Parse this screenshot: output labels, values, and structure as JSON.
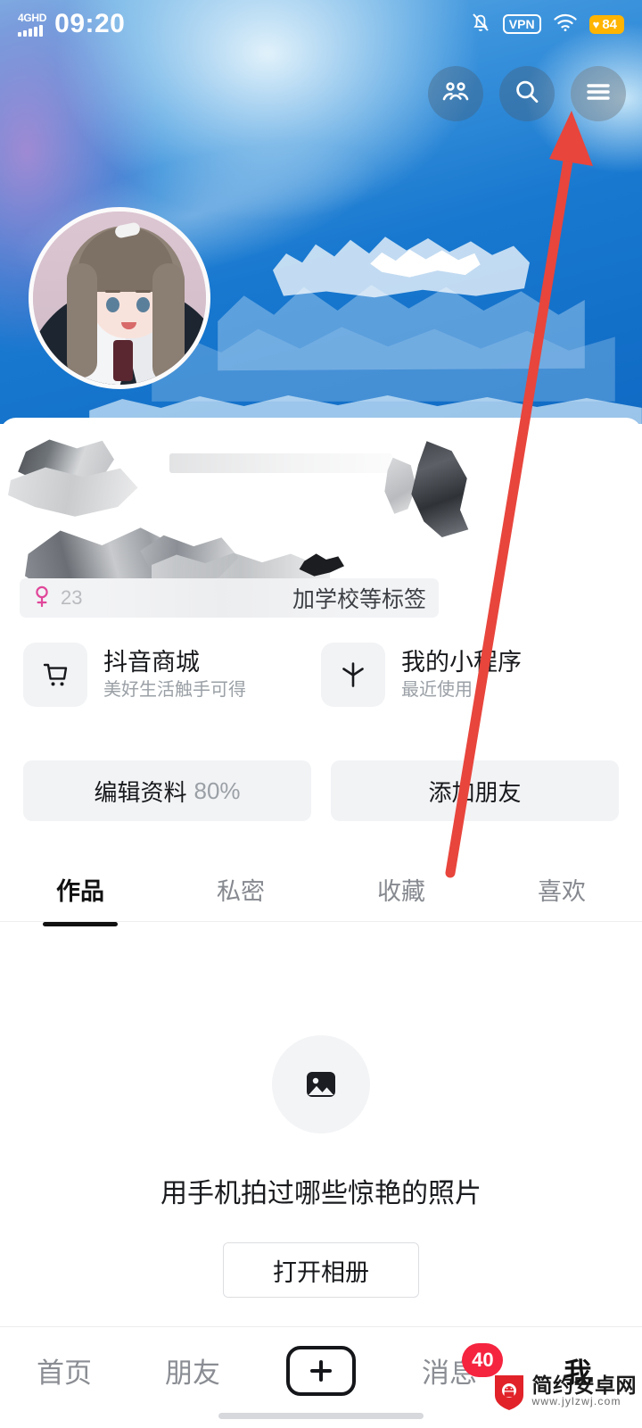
{
  "status_bar": {
    "network_label": "4GHD",
    "time": "09:20",
    "signal_icon": "signal-bars-icon",
    "mute_icon": "bell-muted-icon",
    "vpn_label": "VPN",
    "wifi_icon": "wifi-icon",
    "battery_level": "84",
    "battery_icon": "heart-battery-icon",
    "battery_color": "#FFB400"
  },
  "cover": {
    "actions": [
      {
        "name": "friends-icon",
        "label": "好友"
      },
      {
        "name": "search-icon",
        "label": "搜索"
      },
      {
        "name": "menu-icon",
        "label": "菜单"
      }
    ],
    "avatar_name": "avatar"
  },
  "profile": {
    "age_tag": "23",
    "gender_icon": "female-icon",
    "tag_hint": "加学校等标签",
    "name_redacted": true
  },
  "entries": [
    {
      "icon": "shopping-cart-icon",
      "title": "抖音商城",
      "subtitle": "美好生活触手可得"
    },
    {
      "icon": "mini-program-icon",
      "title": "我的小程序",
      "subtitle": "最近使用"
    }
  ],
  "actions": {
    "edit_profile_label": "编辑资料",
    "edit_profile_percent": "80%",
    "add_friend_label": "添加朋友"
  },
  "tabs": [
    {
      "label": "作品",
      "active": true
    },
    {
      "label": "私密",
      "active": false
    },
    {
      "label": "收藏",
      "active": false
    },
    {
      "label": "喜欢",
      "active": false
    }
  ],
  "empty_state": {
    "icon": "image-placeholder-icon",
    "message": "用手机拍过哪些惊艳的照片",
    "button_label": "打开相册"
  },
  "bottom_nav": [
    {
      "label": "首页",
      "active": false,
      "badge": null
    },
    {
      "label": "朋友",
      "active": false,
      "badge": null
    },
    {
      "label": "",
      "icon": "plus-icon",
      "active": false,
      "badge": null
    },
    {
      "label": "消息",
      "active": false,
      "badge": "40"
    },
    {
      "label": "我",
      "active": true,
      "badge": null
    }
  ],
  "watermark": {
    "site_name": "简约安卓网",
    "url": "www.jylzwj.com",
    "logo_color": "#e12229"
  },
  "annotation": {
    "arrow_color": "#e8453c",
    "points_to": "menu-icon"
  },
  "colors": {
    "cover_blue": "#1878cf",
    "badge_red": "#f5243f",
    "chip_grey": "#f2f3f5",
    "text_dark": "#18191c",
    "text_muted": "#9aa0a6"
  }
}
